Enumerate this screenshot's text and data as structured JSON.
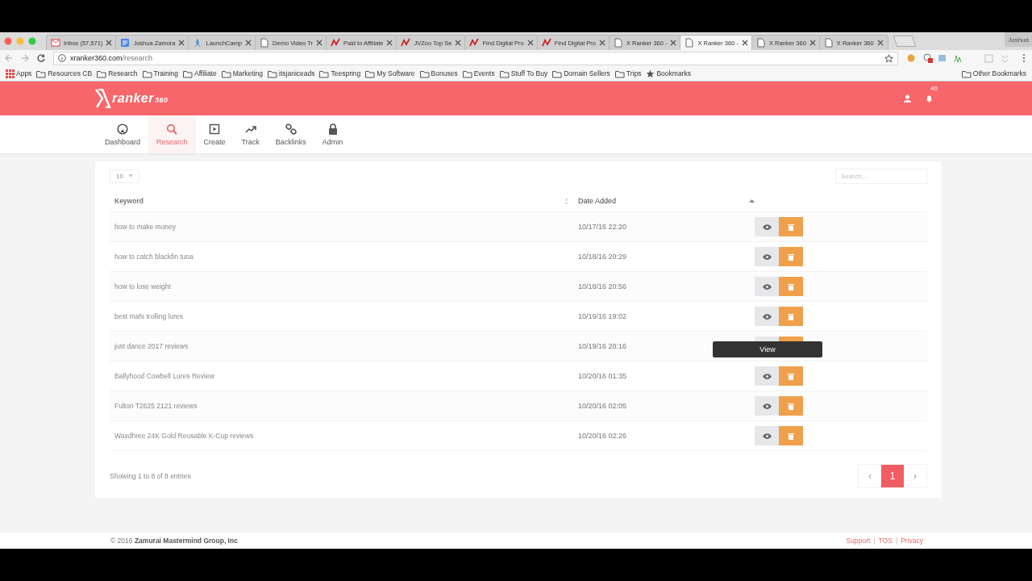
{
  "browser": {
    "tabs": [
      {
        "title": "Inbox (57,571)",
        "kind": "mail",
        "selected": false
      },
      {
        "title": "Joshua Zamora",
        "kind": "doc",
        "selected": false
      },
      {
        "title": "LaunchCamp",
        "kind": "rocket",
        "selected": false
      },
      {
        "title": "Demo Video Tr",
        "kind": "page",
        "selected": false
      },
      {
        "title": "Paid to Affiliate",
        "kind": "chart",
        "selected": false
      },
      {
        "title": "JVZoo Top Se",
        "kind": "chart",
        "selected": false
      },
      {
        "title": "Find Digital Pro",
        "kind": "chart",
        "selected": false
      },
      {
        "title": "Find Digital Pro",
        "kind": "chart",
        "selected": false
      },
      {
        "title": "X Ranker 360 -",
        "kind": "page",
        "selected": false
      },
      {
        "title": "X Ranker 360 -",
        "kind": "page",
        "selected": true
      },
      {
        "title": "X Ranker 360",
        "kind": "page",
        "selected": false
      },
      {
        "title": "X Ranker 360",
        "kind": "page",
        "selected": false
      }
    ],
    "profile": "Joshua",
    "url": {
      "host": "xranker360.com",
      "path": "/research"
    },
    "bookmarks": [
      {
        "label": "Apps",
        "kind": "apps"
      },
      {
        "label": "Resources CB",
        "kind": "folder"
      },
      {
        "label": "Research",
        "kind": "folder"
      },
      {
        "label": "Training",
        "kind": "folder"
      },
      {
        "label": "Affiliate",
        "kind": "folder"
      },
      {
        "label": "Marketing",
        "kind": "folder"
      },
      {
        "label": "itsjaniceads",
        "kind": "folder"
      },
      {
        "label": "Teespring",
        "kind": "folder"
      },
      {
        "label": "My Software",
        "kind": "folder"
      },
      {
        "label": "Bonuses",
        "kind": "folder"
      },
      {
        "label": "Events",
        "kind": "folder"
      },
      {
        "label": "Stuff To Buy",
        "kind": "folder"
      },
      {
        "label": "Domain Sellers",
        "kind": "folder"
      },
      {
        "label": "Trips",
        "kind": "folder"
      },
      {
        "label": "Bookmarks",
        "kind": "star"
      }
    ],
    "other_bookmarks": "Other Bookmarks"
  },
  "app": {
    "logo": {
      "text": "ranker",
      "suffix": "360"
    },
    "notification_count": "40",
    "nav": [
      {
        "label": "Dashboard",
        "kind": "gauge",
        "selected": false
      },
      {
        "label": "Research",
        "kind": "search",
        "selected": true
      },
      {
        "label": "Create",
        "kind": "play",
        "selected": false
      },
      {
        "label": "Track",
        "kind": "trend",
        "selected": false
      },
      {
        "label": "Backlinks",
        "kind": "link",
        "selected": false
      },
      {
        "label": "Admin",
        "kind": "lock",
        "selected": false
      }
    ],
    "page_length": "10",
    "search": {
      "placeholder": "Search..."
    },
    "table": {
      "columns": [
        "Keyword",
        "Date Added"
      ],
      "rows": [
        {
          "keyword": "how to make money",
          "date": "10/17/16 22:20"
        },
        {
          "keyword": "how to catch blackfin tuna",
          "date": "10/18/16 20:29"
        },
        {
          "keyword": "how to lose weight",
          "date": "10/18/16 20:56"
        },
        {
          "keyword": "best mahi trolling lures",
          "date": "10/19/16 19:02"
        },
        {
          "keyword": "just dance 2017 reviews",
          "date": "10/19/16 20:16"
        },
        {
          "keyword": "Ballyhood Cowbell Lures Review",
          "date": "10/20/16 01:35",
          "tooltip": "View"
        },
        {
          "keyword": "Fulton T2625 2121 reviews",
          "date": "10/20/16 02:05"
        },
        {
          "keyword": "Waxdhree 24K Gold Reusable K-Cup reviews",
          "date": "10/20/16 02:26"
        }
      ]
    },
    "info": "Showing 1 to 8 of 8 entries",
    "pagination": {
      "prev": "‹",
      "pages": [
        {
          "label": "1",
          "selected": true
        }
      ],
      "next": "›"
    },
    "footer": {
      "copyright": "© 2016",
      "company": "Zamurai Mastermind Group, Inc",
      "links": [
        {
          "text": "Support",
          "kind": "link"
        },
        {
          "text": "|",
          "kind": "separator"
        },
        {
          "text": "TOS",
          "kind": "link"
        },
        {
          "text": "|",
          "kind": "separator"
        },
        {
          "text": "Privacy",
          "kind": "link"
        }
      ]
    }
  }
}
